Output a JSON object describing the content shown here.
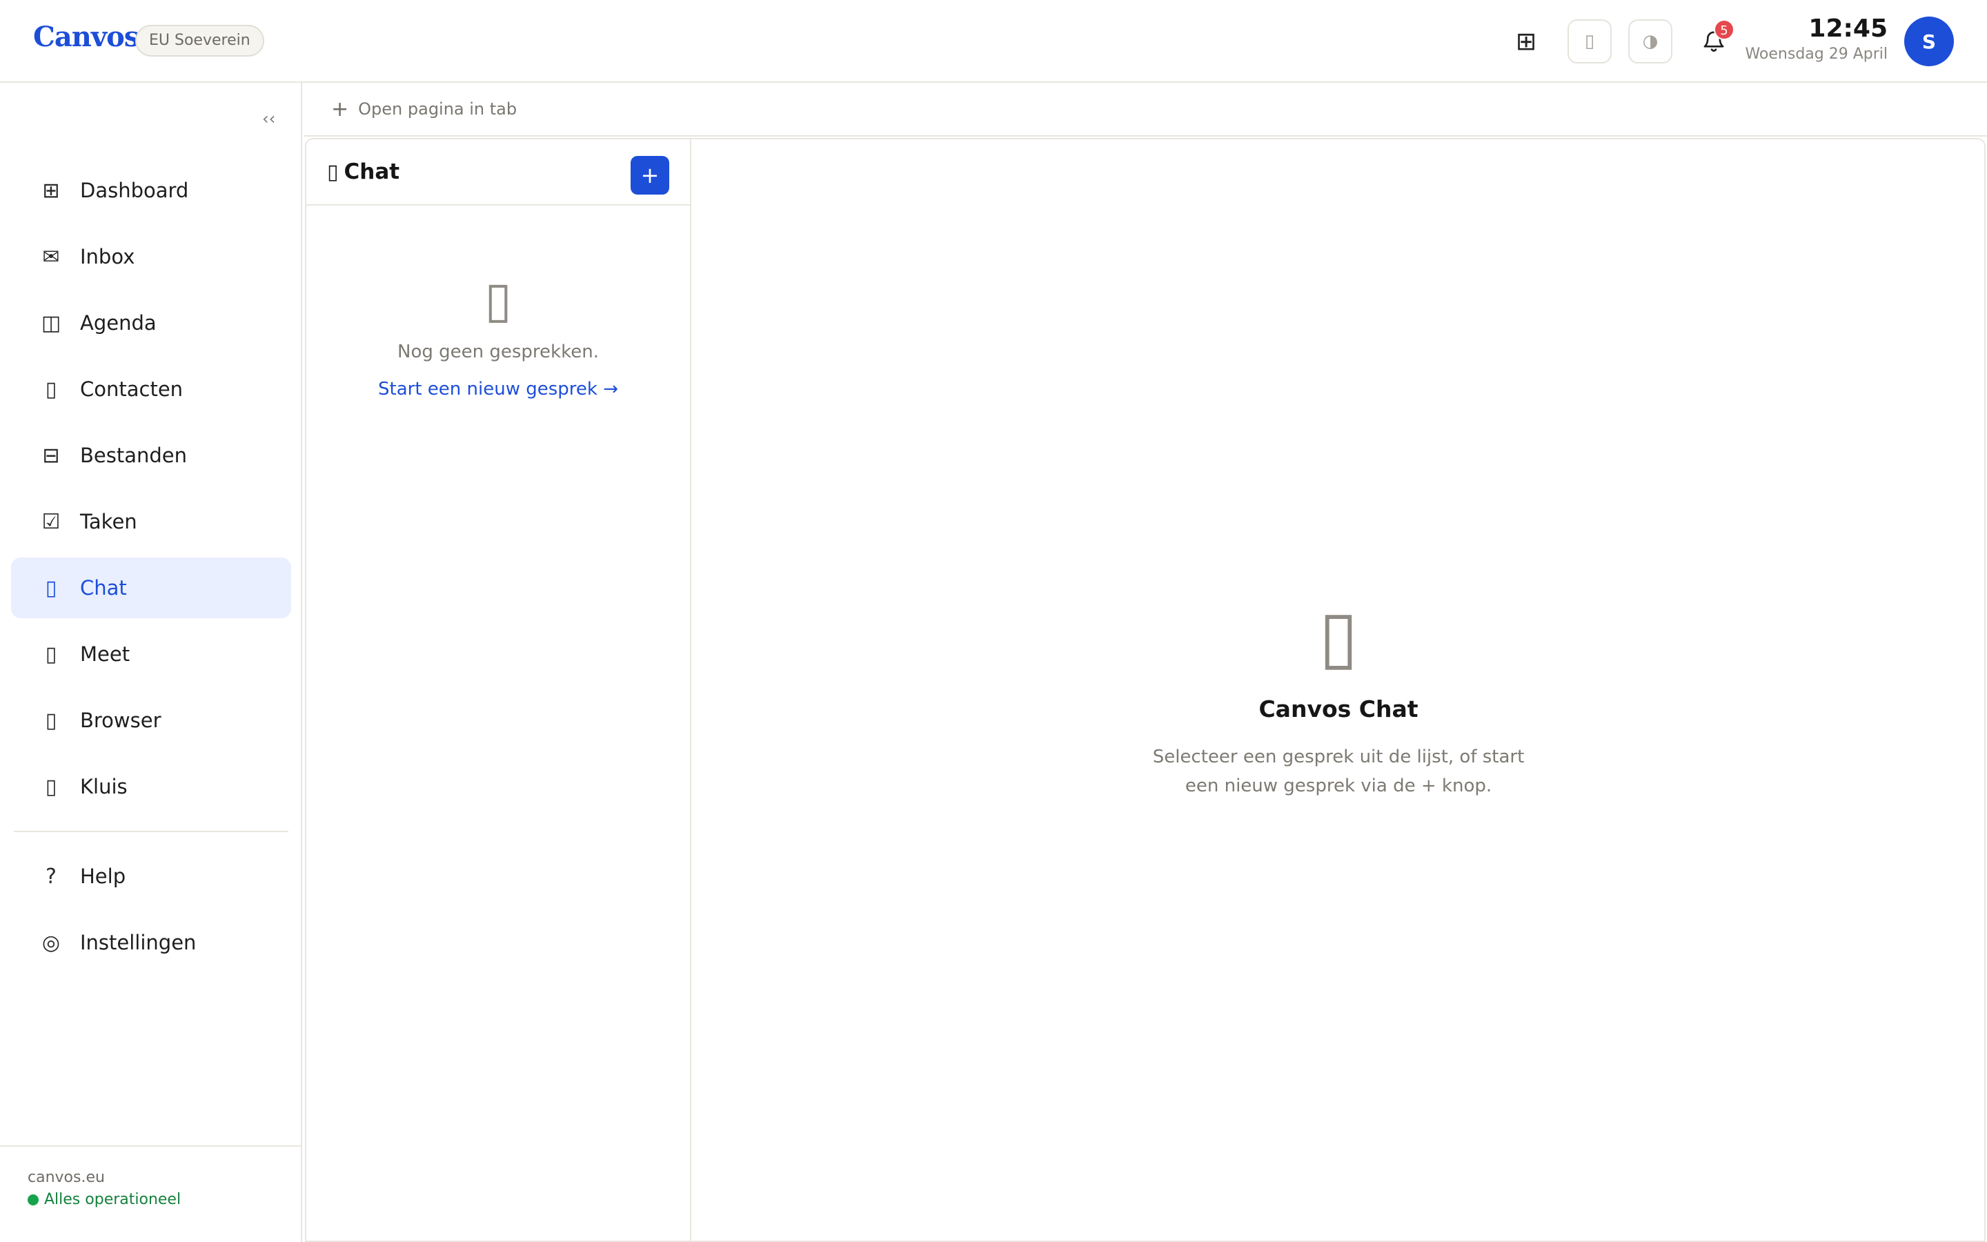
{
  "header": {
    "logo": "Canvos",
    "region_badge": "EU Soeverein",
    "notification_count": "5",
    "time": "12:45",
    "date": "Woensdag 29 April",
    "avatar_initial": "S",
    "icons": {
      "apps": "⊞",
      "layout": "▯",
      "theme": "◑",
      "bell": "bell-icon"
    }
  },
  "sidebar": {
    "collapse_glyph": "‹‹",
    "items": [
      {
        "label": "Dashboard",
        "icon": "⊞",
        "icon_name": "dashboard-icon"
      },
      {
        "label": "Inbox",
        "icon": "✉",
        "icon_name": "inbox-icon"
      },
      {
        "label": "Agenda",
        "icon": "◫",
        "icon_name": "agenda-icon"
      },
      {
        "label": "Contacten",
        "icon": "▯",
        "icon_name": "contacts-icon"
      },
      {
        "label": "Bestanden",
        "icon": "⊟",
        "icon_name": "files-icon"
      },
      {
        "label": "Taken",
        "icon": "☑",
        "icon_name": "tasks-icon"
      },
      {
        "label": "Chat",
        "icon": "▯",
        "icon_name": "chat-icon",
        "active": true
      },
      {
        "label": "Meet",
        "icon": "▯",
        "icon_name": "meet-icon"
      },
      {
        "label": "Browser",
        "icon": "▯",
        "icon_name": "browser-icon"
      },
      {
        "label": "Kluis",
        "icon": "▯",
        "icon_name": "vault-icon"
      }
    ],
    "bottom_items": [
      {
        "label": "Help",
        "icon": "?",
        "icon_name": "help-icon"
      },
      {
        "label": "Instellingen",
        "icon": "◎",
        "icon_name": "settings-icon"
      }
    ],
    "footer": {
      "domain": "canvos.eu",
      "status": "Alles operationeel",
      "status_color": "#16a34a"
    }
  },
  "tabstrip": {
    "plus": "+",
    "label": "Open pagina in tab"
  },
  "chat_list": {
    "icon": "▯",
    "title": "Chat",
    "new_button": "+",
    "empty_icon": "▯",
    "empty_message": "Nog geen gesprekken.",
    "start_link": "Start een nieuw gesprek →"
  },
  "chat_detail": {
    "empty_icon": "▯",
    "title": "Canvos Chat",
    "subtitle": "Selecteer een gesprek uit de lijst, of start een nieuw gesprek via de + knop."
  },
  "colors": {
    "accent": "#1d4ed8",
    "active_bg": "#e9efff",
    "badge": "#e5484d",
    "border": "#e9e6df"
  }
}
